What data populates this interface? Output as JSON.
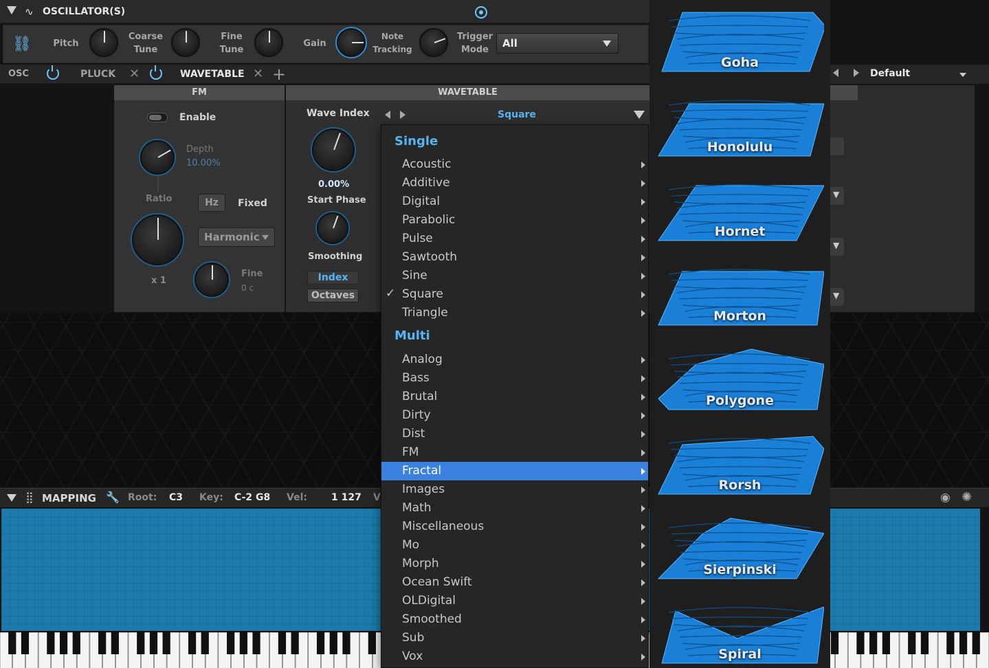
{
  "header": {
    "title": "OSCILLATOR(S)"
  },
  "controls": {
    "pitch": "Pitch",
    "coarse_tune": [
      "Coarse",
      "Tune"
    ],
    "fine_tune": [
      "Fine",
      "Tune"
    ],
    "gain": "Gain",
    "note_tracking": [
      "Note",
      "Tracking"
    ],
    "trigger_mode": [
      "Trigger",
      "Mode"
    ],
    "trigger_value": "All"
  },
  "tabs": {
    "osc": "OSC",
    "pluck": "PLUCK",
    "wavetable": "WAVETABLE"
  },
  "preset": {
    "value": "Default"
  },
  "fm": {
    "header": "FM",
    "enable": "Enable",
    "depth_label": "Depth",
    "depth_value": "10.00%",
    "ratio_label": "Ratio",
    "hz_button": "Hz",
    "fixed_label": "Fixed",
    "harmonic": "Harmonic",
    "ratio_value": "x 1",
    "fine_label": "Fine",
    "fine_value": "0 c"
  },
  "wavetable": {
    "header": "WAVETABLE",
    "wave_index": "Wave Index",
    "current": "Square",
    "start_phase_value": "0.00%",
    "start_phase": "Start Phase",
    "smoothing": "Smoothing",
    "index_btn": "Index",
    "octaves_btn": "Octaves"
  },
  "menu": {
    "single_header": "Single",
    "single": [
      "Acoustic",
      "Additive",
      "Digital",
      "Parabolic",
      "Pulse",
      "Sawtooth",
      "Sine",
      "Square",
      "Triangle"
    ],
    "checked": "Square",
    "multi_header": "Multi",
    "multi": [
      "Analog",
      "Bass",
      "Brutal",
      "Dirty",
      "Dist",
      "FM",
      "Fractal",
      "Images",
      "Math",
      "Miscellaneous",
      "Mo",
      "Morph",
      "Ocean Swift",
      "OLDigital",
      "Smoothed",
      "Sub",
      "Vox"
    ],
    "highlighted": "Fractal"
  },
  "thumbnails": [
    "Goha",
    "Honolulu",
    "Hornet",
    "Morton",
    "Polygone",
    "Rorsh",
    "Sierpinski",
    "Spiral"
  ],
  "mapping": {
    "title": "MAPPING",
    "root_label": "Root:",
    "root_value": "C3",
    "key_label": "Key:",
    "key_value": "C-2 G8",
    "vel_label": "Vel:",
    "vel_value": "1 127",
    "trunc": "V"
  },
  "colors": {
    "accent": "#56b4f3",
    "highlight": "#3b82e0",
    "wave_blue": "#1a7fd6",
    "keymap": "#1c7bab"
  }
}
